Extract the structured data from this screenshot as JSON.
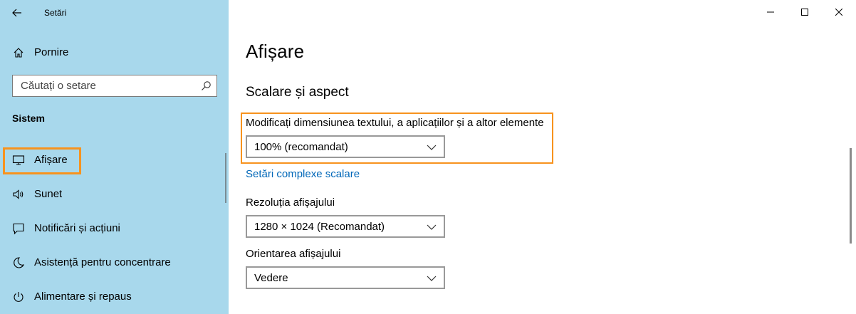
{
  "window": {
    "title": "Setări"
  },
  "sidebar": {
    "home_label": "Pornire",
    "search": {
      "placeholder": "Căutați o setare"
    },
    "section_heading": "Sistem",
    "items": [
      {
        "label": "Afișare",
        "icon": "monitor-icon",
        "selected": true
      },
      {
        "label": "Sunet",
        "icon": "speaker-icon",
        "selected": false
      },
      {
        "label": "Notificări și acțiuni",
        "icon": "notification-icon",
        "selected": false
      },
      {
        "label": "Asistență pentru concentrare",
        "icon": "moon-icon",
        "selected": false
      },
      {
        "label": "Alimentare și repaus",
        "icon": "power-icon",
        "selected": false
      }
    ]
  },
  "main": {
    "title": "Afișare",
    "scale_section_heading": "Scalare și aspect",
    "scale": {
      "label": "Modificați dimensiunea textului, a aplicațiilor și a altor elemente",
      "value": "100% (recomandat)"
    },
    "advanced_scaling_link": "Setări complexe scalare",
    "resolution": {
      "label": "Rezoluția afișajului",
      "value": "1280 × 1024 (Recomandat)"
    },
    "orientation": {
      "label": "Orientarea afișajului",
      "value": "Vedere"
    }
  },
  "colors": {
    "sidebar_bg": "#a8d8ec",
    "highlight": "#f7931e",
    "link": "#0067b8"
  }
}
